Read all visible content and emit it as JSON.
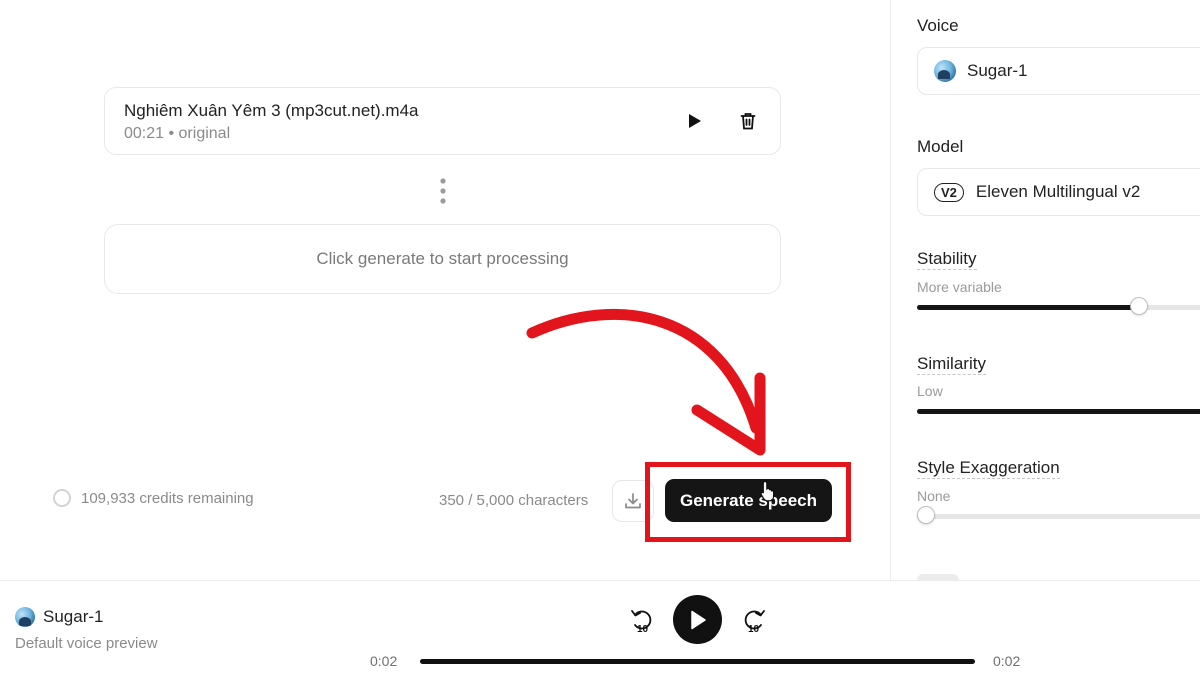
{
  "main": {
    "file": {
      "name": "Nghiêm Xuân Yêm 3 (mp3cut.net).m4a",
      "meta": "00:21 • original"
    },
    "generate_placeholder": "Click generate to start processing",
    "credits": "109,933 credits remaining",
    "char_count": "350 / 5,000 characters",
    "generate_label": "Generate speech",
    "accent_color": "#e3151c"
  },
  "sidebar": {
    "voice": {
      "label": "Voice",
      "selected": "Sugar-1"
    },
    "model": {
      "label": "Model",
      "badge": "V2",
      "selected": "Eleven Multilingual v2"
    },
    "stability": {
      "label": "Stability",
      "hint": "More variable",
      "value": 0.74
    },
    "similarity": {
      "label": "Similarity",
      "hint": "Low",
      "value": 1.0
    },
    "style": {
      "label": "Style Exaggeration",
      "hint": "None",
      "value": 0.0
    }
  },
  "player": {
    "voice_name": "Sugar-1",
    "subtitle": "Default voice preview",
    "skip_back": "10",
    "skip_forward": "10",
    "time_elapsed": "0:02",
    "time_total": "0:02",
    "progress": 1.0
  }
}
